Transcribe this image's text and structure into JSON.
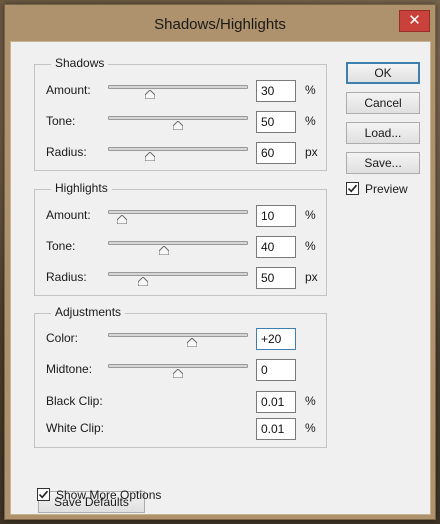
{
  "dialog": {
    "title": "Shadows/Highlights",
    "close_glyph": "✕"
  },
  "shadows": {
    "label": "Shadows",
    "rows": [
      {
        "label": "Amount:",
        "value": "30",
        "unit": "%",
        "slider_fraction": 0.3
      },
      {
        "label": "Tone:",
        "value": "50",
        "unit": "%",
        "slider_fraction": 0.5
      },
      {
        "label": "Radius:",
        "value": "60",
        "unit": "px",
        "slider_fraction": 0.3
      }
    ]
  },
  "highlights": {
    "label": "Highlights",
    "rows": [
      {
        "label": "Amount:",
        "value": "10",
        "unit": "%",
        "slider_fraction": 0.1
      },
      {
        "label": "Tone:",
        "value": "40",
        "unit": "%",
        "slider_fraction": 0.4
      },
      {
        "label": "Radius:",
        "value": "50",
        "unit": "px",
        "slider_fraction": 0.25
      }
    ]
  },
  "adjustments": {
    "label": "Adjustments",
    "rows": [
      {
        "label": "Color:",
        "value": "+20",
        "unit": "",
        "slider_fraction": 0.6
      },
      {
        "label": "Midtone:",
        "value": "0",
        "unit": "",
        "slider_fraction": 0.5
      },
      {
        "label": "Black Clip:",
        "value": "0.01",
        "unit": "%"
      },
      {
        "label": "White Clip:",
        "value": "0.01",
        "unit": "%"
      }
    ]
  },
  "buttons": {
    "ok": "OK",
    "cancel": "Cancel",
    "load": "Load...",
    "save": "Save...",
    "save_defaults": "Save Defaults"
  },
  "preview": {
    "label": "Preview",
    "checked": true
  },
  "show_more_options": {
    "label": "Show More Options",
    "checked": true
  },
  "colors": {
    "title_bar": "#ae916d",
    "close_button": "#c8413b",
    "focus_border": "#3c7fb1"
  }
}
